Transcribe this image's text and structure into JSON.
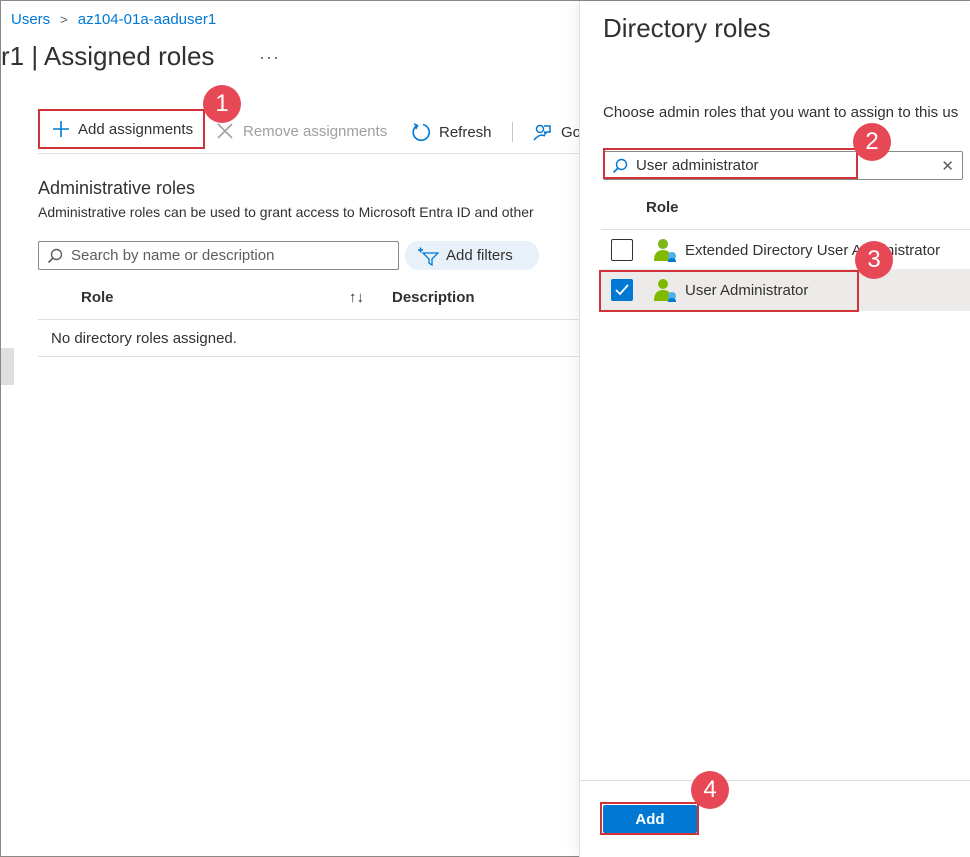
{
  "breadcrumb": {
    "items": [
      "Users",
      "az104-01a-aaduser1"
    ]
  },
  "page": {
    "title": "r1 | Assigned roles",
    "more": "···"
  },
  "toolbar": {
    "add_assignments": "Add assignments",
    "remove_assignments": "Remove assignments",
    "refresh": "Refresh",
    "go": "Go"
  },
  "section": {
    "title": "Administrative roles",
    "description": "Administrative roles can be used to grant access to Microsoft Entra ID and other"
  },
  "search": {
    "placeholder": "Search by name or description"
  },
  "filters": {
    "label": "Add filters"
  },
  "table": {
    "columns": [
      "Role",
      "Description"
    ],
    "sort_icon": "↑↓",
    "empty": "No directory roles assigned."
  },
  "panel": {
    "title": "Directory roles",
    "description": "Choose admin roles that you want to assign to this us",
    "search_value": "User administrator",
    "column": "Role",
    "roles": [
      {
        "label": "Extended Directory User Administrator",
        "checked": false
      },
      {
        "label": "User Administrator",
        "checked": true
      }
    ],
    "add_button": "Add"
  },
  "callouts": [
    "1",
    "2",
    "3",
    "4"
  ],
  "colors": {
    "accent": "#0078d4",
    "callout": "#e74856",
    "highlight": "#d13438"
  }
}
